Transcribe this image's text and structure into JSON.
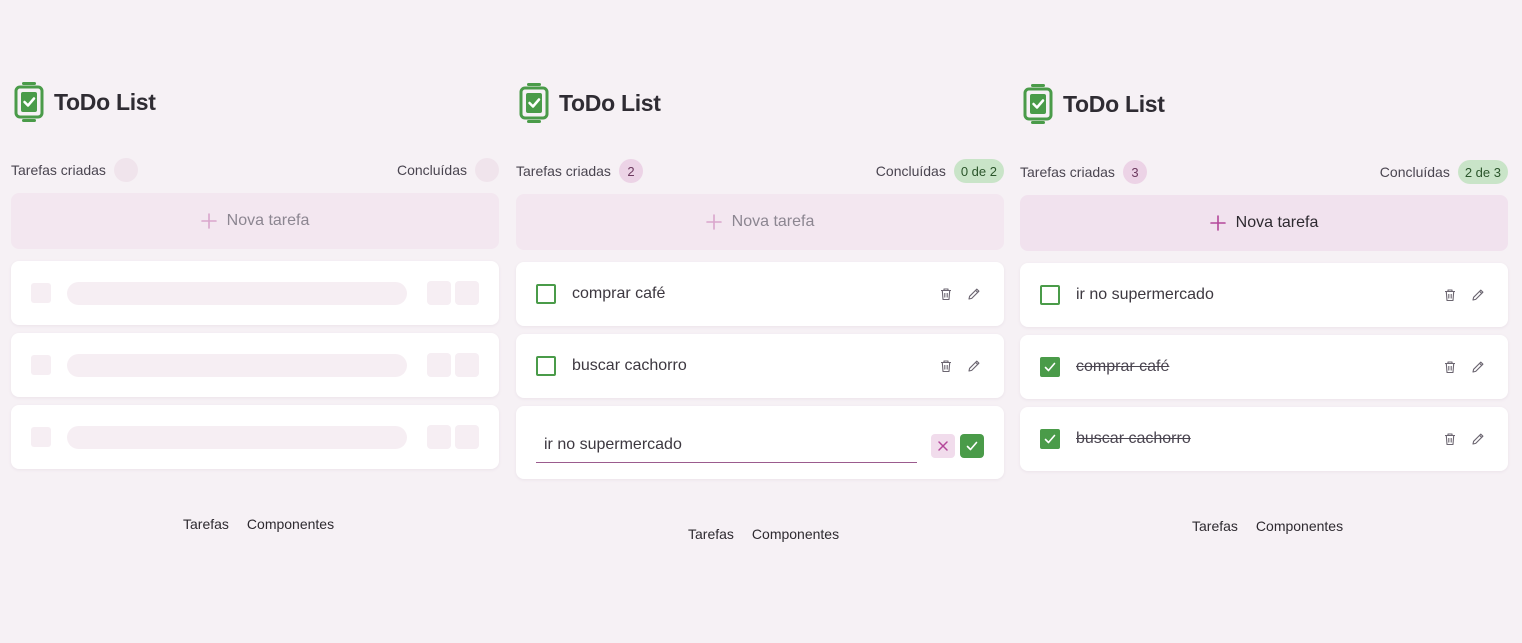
{
  "app_title": "ToDo List",
  "stats": {
    "created_label": "Tarefas criadas",
    "done_label": "Concluídas"
  },
  "new_task_label": "Nova tarefa",
  "nav": {
    "tasks": "Tarefas",
    "components": "Componentes"
  },
  "panels": [
    {
      "state": "loading",
      "created_count": "",
      "done_count": ""
    },
    {
      "state": "editing",
      "created_count": "2",
      "done_count": "0 de 2",
      "tasks": [
        {
          "text": "comprar café",
          "done": false
        },
        {
          "text": "buscar cachorro",
          "done": false
        }
      ],
      "edit_value": "ir no supermercado"
    },
    {
      "state": "list",
      "created_count": "3",
      "done_count": "2 de 3",
      "tasks": [
        {
          "text": "ir no supermercado",
          "done": false
        },
        {
          "text": "comprar café",
          "done": true
        },
        {
          "text": "buscar cachorro",
          "done": true
        }
      ]
    }
  ],
  "colors": {
    "brand_green": "#4a9b49",
    "accent_pink": "#9b5b8e",
    "background": "#f6f1f5"
  },
  "icons": [
    "todo-logo-icon",
    "plus-icon",
    "trash-icon",
    "pencil-icon",
    "check-icon",
    "x-icon"
  ]
}
